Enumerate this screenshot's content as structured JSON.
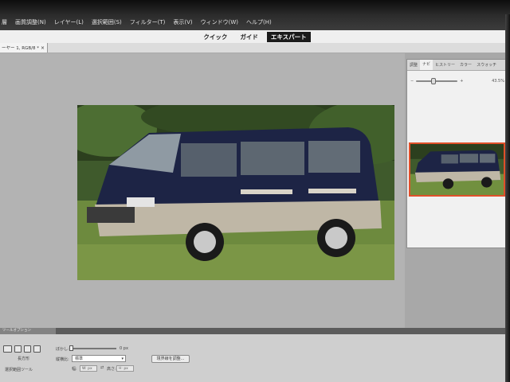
{
  "menubar": {
    "items": [
      "層",
      "画質調整(N)",
      "レイヤー(L)",
      "選択範囲(S)",
      "フィルター(T)",
      "表示(V)",
      "ウィンドウ(W)",
      "ヘルプ(H)"
    ]
  },
  "modebar": {
    "quick": "クイック",
    "guide": "ガイド",
    "expert": "エキスパート"
  },
  "document_tab": {
    "label": "ーヤー 1, RGB/8 *",
    "close": "×"
  },
  "navigator": {
    "tabs": [
      "調整",
      "ナビ",
      "ヒストリー",
      "カラー",
      "スウォッチ"
    ],
    "zoom_percent": "43.5%",
    "zoom_minus": "−",
    "zoom_plus": "+",
    "zoom_level": 0.42
  },
  "bottom_bar": {
    "tab_label": "ツールオプション"
  },
  "options": {
    "tool_name": "長方形",
    "tool_group": "選択範囲ツール",
    "feather_label": "ぼかし:",
    "feather_value": "0 px",
    "aspect_label": "縦横比:",
    "aspect_value": "標準",
    "width_label": "幅:",
    "width_value": "W: px",
    "height_label": "高さ:",
    "height_value": "H: px",
    "refine_button": "境界線を調整..."
  },
  "colors": {
    "accent_active_mode": "#1b1b1b",
    "thumb_border": "#e0502a"
  }
}
